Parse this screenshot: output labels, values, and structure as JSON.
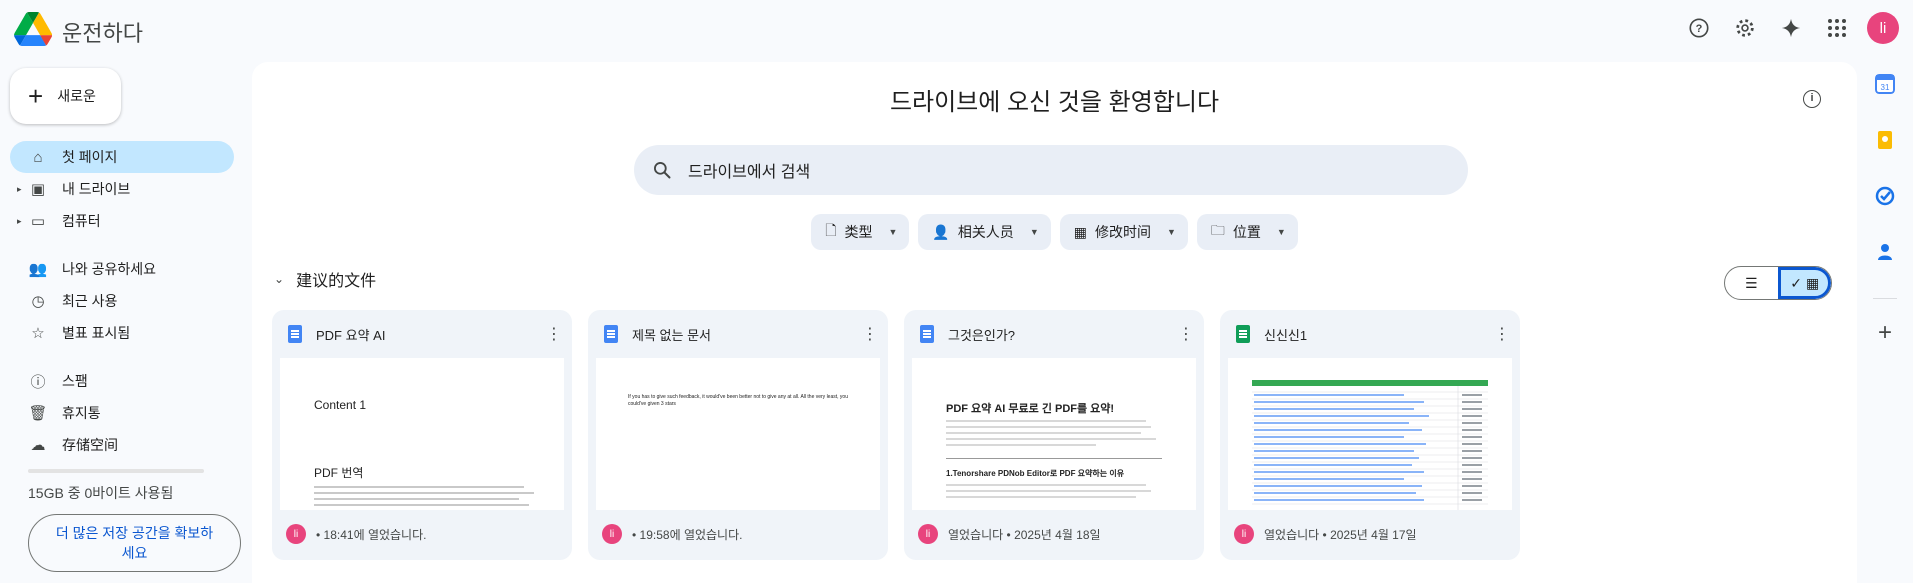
{
  "app": {
    "title": "운전하다"
  },
  "top_icons": [
    "help-icon",
    "settings-icon",
    "gemini-icon",
    "apps-icon"
  ],
  "user": {
    "initial": "li",
    "avatar_color": "#e8447d"
  },
  "sidebar": {
    "new_label": "새로운",
    "items": [
      {
        "label": "첫 페이지",
        "icon": "home-icon"
      },
      {
        "label": "내 드라이브",
        "icon": "my-drive-icon"
      },
      {
        "label": "컴퓨터",
        "icon": "computer-icon"
      },
      {
        "label": "나와 공유하세요",
        "icon": "shared-icon"
      },
      {
        "label": "최근 사용",
        "icon": "clock-icon"
      },
      {
        "label": "별표 표시됨",
        "icon": "star-icon"
      },
      {
        "label": "스팸",
        "icon": "spam-icon"
      },
      {
        "label": "휴지통",
        "icon": "trash-icon"
      },
      {
        "label": "存储空间",
        "icon": "cloud-icon"
      }
    ],
    "storage_text": "15GB 중 0바이트 사용됨",
    "storage_button": "더 많은 저장 공간을 확보하세요"
  },
  "main": {
    "welcome": "드라이브에 오신 것을 환영합니다",
    "search_placeholder": "드라이브에서 검색",
    "filters": [
      "类型",
      "相关人员",
      "修改时间",
      "位置"
    ],
    "section_title": "建议的文件",
    "cards": [
      {
        "title": "PDF 요약 AI",
        "type": "docs",
        "footer": "• 18:41에 열었습니다.",
        "thumb_heading": "Content 1",
        "thumb_sub": "PDF 번역"
      },
      {
        "title": "제목 없는 문서",
        "type": "docs",
        "footer": "• 19:58에 열었습니다.",
        "thumb_body": "If you has to give such feedback, it would've been better not to give any at all. All the very least, you could've given 3 stars"
      },
      {
        "title": "그것은인가?",
        "type": "docs",
        "footer": "열었습니다 • 2025년 4월 18일",
        "thumb_heading": "PDF 요약 AI 무료로 긴 PDF를 요약!",
        "thumb_sub": "1.Tenorshare PDNob Editor로 PDF 요약하는 이유"
      },
      {
        "title": "신신신1",
        "type": "sheets",
        "footer": "열었습니다 • 2025년 4월 17일"
      }
    ]
  },
  "colors": {
    "accent": "#0b57d0",
    "active_nav": "#c2e7ff",
    "search_bg": "#e9eef6"
  }
}
